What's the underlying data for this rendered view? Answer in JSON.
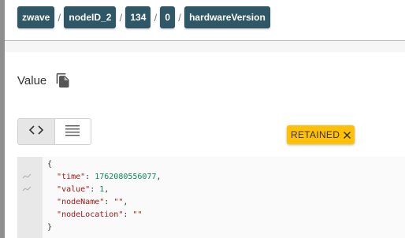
{
  "breadcrumb": [
    "zwave",
    "nodeID_2",
    "134",
    "0",
    "hardwareVersion"
  ],
  "breadcrumb_separator": "/",
  "value_section": {
    "label": "Value",
    "copy_icon": "copy-icon"
  },
  "view_toggle": {
    "code_icon": "<>",
    "list_icon": "lines-icon",
    "active": "code"
  },
  "retained_badge": {
    "label": "RETAINED",
    "close_icon": "close-icon",
    "color": "#ffc107"
  },
  "payload": {
    "open": "{",
    "lines": [
      {
        "key": "\"time\"",
        "value": "1762080556077",
        "suffix": ","
      },
      {
        "key": "\"value\"",
        "value": "1",
        "suffix": ","
      },
      {
        "key": "\"nodeName\"",
        "value": "\"\"",
        "suffix": ","
      },
      {
        "key": "\"nodeLocation\"",
        "value": "\"\"",
        "suffix": ""
      }
    ],
    "close": "}"
  },
  "colors": {
    "breadcrumb_bg": "#2f5766",
    "badge": "#ffc107",
    "json_key": "#a31515"
  }
}
